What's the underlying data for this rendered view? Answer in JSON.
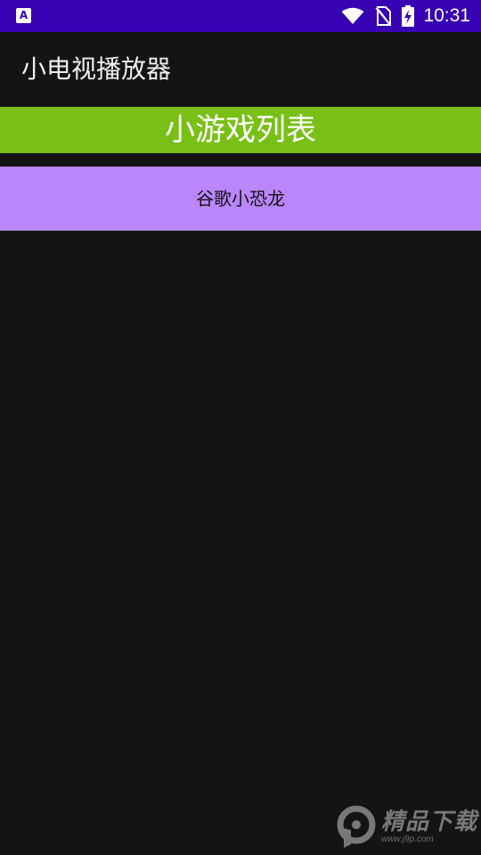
{
  "status_bar": {
    "time": "10:31",
    "app_icon_letter": "A",
    "icons": [
      "app-notification-icon",
      "wifi-icon",
      "no-sim-icon",
      "battery-charging-icon"
    ],
    "background": "#3700b3"
  },
  "app_bar": {
    "title": "小电视播放器"
  },
  "list": {
    "header": "小游戏列表",
    "header_color": "#78c016",
    "items": [
      {
        "label": "谷歌小恐龙",
        "color": "#bb86fc"
      }
    ]
  },
  "watermark": {
    "title": "精品下载",
    "url": "www.j9p.com"
  }
}
